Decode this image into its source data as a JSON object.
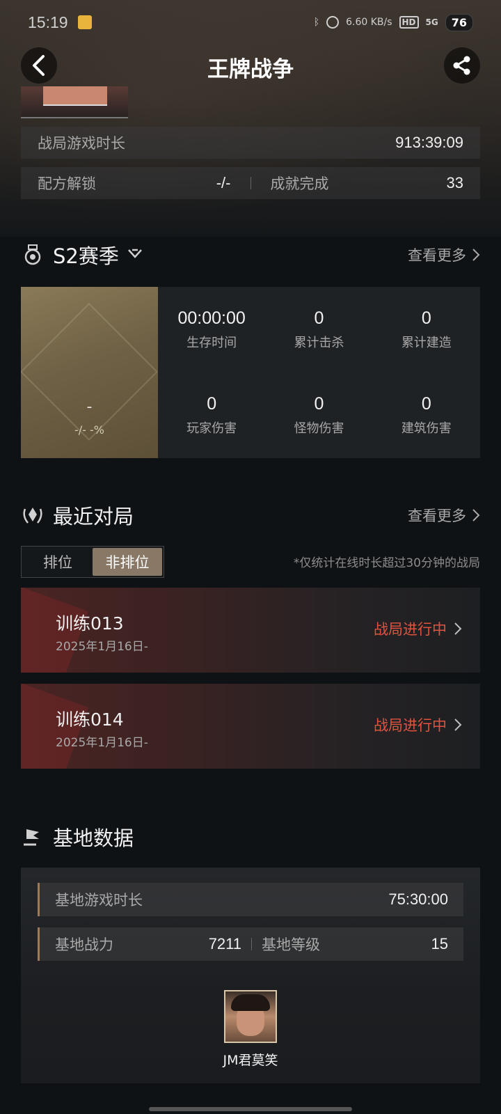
{
  "status_bar": {
    "time": "15:19",
    "net_speed": "6.60 KB/s",
    "hd": "HD",
    "signal": "5G",
    "battery": "76"
  },
  "header": {
    "title": "王牌战争"
  },
  "profile_stats": {
    "battle_time_label": "战局游戏时长",
    "battle_time_value": "913:39:09",
    "recipe_label": "配方解锁",
    "recipe_value": "-/-",
    "achievement_label": "成就完成",
    "achievement_value": "33"
  },
  "season": {
    "title": "S2赛季",
    "more": "查看更多",
    "rank": "-",
    "rank_pct": "-/- -%",
    "stats": [
      {
        "value": "00:00:00",
        "label": "生存时间"
      },
      {
        "value": "0",
        "label": "累计击杀"
      },
      {
        "value": "0",
        "label": "累计建造"
      },
      {
        "value": "0",
        "label": "玩家伤害"
      },
      {
        "value": "0",
        "label": "怪物伤害"
      },
      {
        "value": "0",
        "label": "建筑伤害"
      }
    ]
  },
  "recent": {
    "title": "最近对局",
    "more": "查看更多",
    "tabs": [
      "排位",
      "非排位"
    ],
    "active_tab": "非排位",
    "note": "*仅统计在线时长超过30分钟的战局",
    "matches": [
      {
        "name": "训练013",
        "date": "2025年1月16日-",
        "status": "战局进行中"
      },
      {
        "name": "训练014",
        "date": "2025年1月16日-",
        "status": "战局进行中"
      }
    ]
  },
  "base": {
    "title": "基地数据",
    "play_time_label": "基地游戏时长",
    "play_time_value": "75:30:00",
    "power_label": "基地战力",
    "power_value": "7211",
    "level_label": "基地等级",
    "level_value": "15",
    "player_name": "JM君莫笑"
  },
  "colors": {
    "accent_red": "#e2533f",
    "tab_active": "#8a7866",
    "bg": "#0f1215"
  }
}
